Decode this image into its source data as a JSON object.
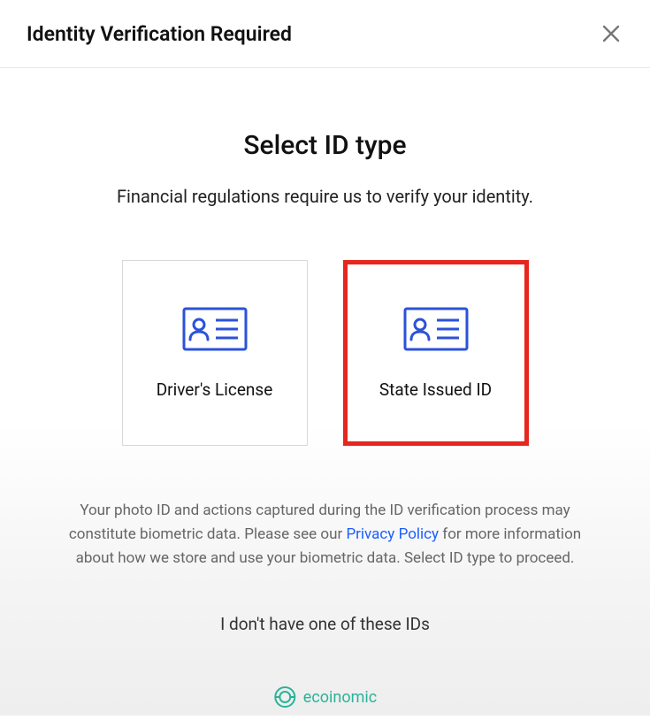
{
  "header": {
    "title": "Identity Verification Required"
  },
  "main": {
    "title": "Select ID type",
    "subtitle": "Financial regulations require us to verify your identity.",
    "options": [
      {
        "label": "Driver's License",
        "highlighted": false
      },
      {
        "label": "State Issued ID",
        "highlighted": true
      }
    ],
    "disclaimer_before": "Your photo ID and actions captured during the ID verification process may constitute biometric data. Please see our ",
    "disclaimer_link": "Privacy Policy",
    "disclaimer_after": " for more information about how we store and use your biometric data. Select ID type to proceed.",
    "no_id_text": "I don't have one of these IDs"
  },
  "footer": {
    "brand": "ecoinomic"
  },
  "colors": {
    "icon_blue": "#2b52d9",
    "highlight_red": "#e6261f",
    "link_blue": "#1a5eff",
    "brand_teal": "#2bb39a"
  }
}
